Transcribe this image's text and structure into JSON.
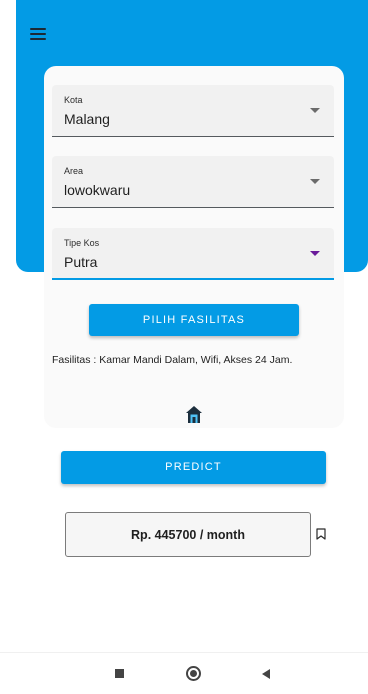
{
  "header": {
    "menu_icon": "hamburger-menu-icon",
    "color": "#039be5"
  },
  "form": {
    "kota": {
      "label": "Kota",
      "value": "Malang"
    },
    "area": {
      "label": "Area",
      "value": "lowokwaru"
    },
    "tipe_kos": {
      "label": "Tipe Kos",
      "value": "Putra"
    },
    "pilih_fasilitas_label": "PILIH FASILITAS",
    "fasilitas_text": "Fasilitas : Kamar Mandi Dalam, Wifi, Akses 24 Jam.",
    "home_icon": "home-icon"
  },
  "predict_label": "PREDICT",
  "result": {
    "text": "Rp. 445700 / month",
    "bookmark_icon": "bookmark-icon"
  },
  "navbar": {
    "icons": [
      "recents-square-icon",
      "home-circle-icon",
      "back-triangle-icon"
    ]
  }
}
